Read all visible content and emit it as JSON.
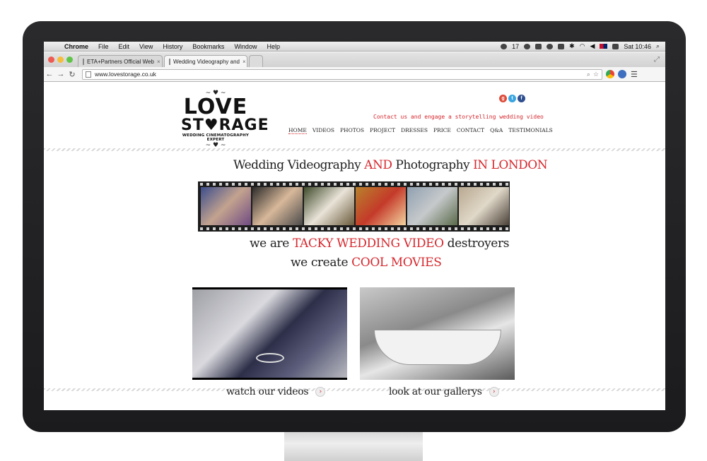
{
  "menubar": {
    "items": [
      "Chrome",
      "File",
      "Edit",
      "View",
      "History",
      "Bookmarks",
      "Window",
      "Help"
    ],
    "badge": "17",
    "clock": "Sat 10:46"
  },
  "tabs": [
    {
      "label": "ETA+Partners Official Web"
    },
    {
      "label": "Wedding Videography and"
    }
  ],
  "omnibox": {
    "url": "www.lovestorage.co.uk"
  },
  "site": {
    "logo": {
      "line1": "LOVE",
      "line2": "ST♥RAGE",
      "line3": "WEDDING CINEMATOGRAPHY EXPERT"
    },
    "tagline": "Contact us and engage a storytelling wedding video",
    "nav": [
      "HOME",
      "VIDEOS",
      "PHOTOS",
      "PROJECT",
      "DRESSES",
      "PRICE",
      "CONTACT",
      "Q&A",
      "TESTIMONIALS"
    ],
    "headline": {
      "a": "Wedding Videography",
      "b": "AND",
      "c": "Photography",
      "d": "IN LONDON"
    },
    "slogan1": {
      "a": "we are",
      "b": "TACKY WEDDING VIDEO",
      "c": "destroyers"
    },
    "slogan2": {
      "a": "we create",
      "b": "COOL MOVIES"
    },
    "cards": {
      "videos": "watch our videos",
      "galleries": "look at our gallerys"
    }
  },
  "colors": {
    "accent": "#d6282e"
  }
}
